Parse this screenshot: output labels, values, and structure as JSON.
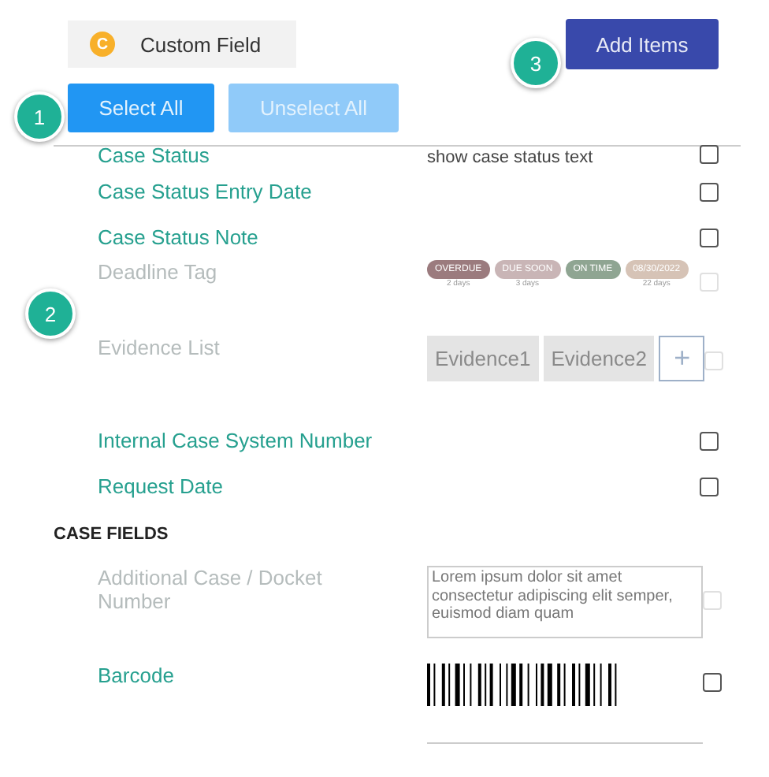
{
  "custom_field": {
    "badge": "C",
    "label": "Custom Field"
  },
  "add_button": "Add Items",
  "select_buttons": [
    {
      "label": "Select All",
      "disabled": false
    },
    {
      "label": "Unselect All",
      "disabled": true
    }
  ],
  "callouts": [
    "1",
    "2",
    "3"
  ],
  "rows": [
    {
      "kind": "text",
      "label": "Case Status",
      "preview": "show case status text",
      "disabled": false,
      "checked": false
    },
    {
      "kind": "none",
      "label": "Case Status Entry Date",
      "disabled": false,
      "checked": false
    },
    {
      "kind": "none",
      "label": "Case Status Note",
      "disabled": false,
      "checked": false
    },
    {
      "kind": "tags",
      "label": "Deadline Tag",
      "disabled": true,
      "checked": false,
      "tags": [
        {
          "text": "OVERDUE",
          "note": "2 days",
          "color": "#9b7b7e"
        },
        {
          "text": "DUE SOON",
          "note": "3 days",
          "color": "#c9b5b6"
        },
        {
          "text": "ON TIME",
          "color": "#8fa592"
        },
        {
          "text": "08/30/2022",
          "note": "22 days",
          "color": "#d6c3b6"
        }
      ]
    },
    {
      "kind": "evidence",
      "label": "Evidence List",
      "disabled": true,
      "checked": false,
      "items": [
        "Evidence1",
        "Evidence2"
      ],
      "add": "+"
    },
    {
      "kind": "none",
      "label": "Internal Case System Number",
      "disabled": false,
      "checked": false
    },
    {
      "kind": "none",
      "label": "Request Date",
      "disabled": false,
      "checked": false
    },
    {
      "kind": "section",
      "label": "CASE FIELDS"
    },
    {
      "kind": "textarea",
      "label": "Additional Case / Docket Number",
      "disabled": true,
      "checked": false,
      "value": "Lorem ipsum dolor sit amet consectetur adipiscing elit semper, euismod diam quam"
    },
    {
      "kind": "barcode",
      "label": "Barcode",
      "disabled": false,
      "checked": false
    }
  ]
}
